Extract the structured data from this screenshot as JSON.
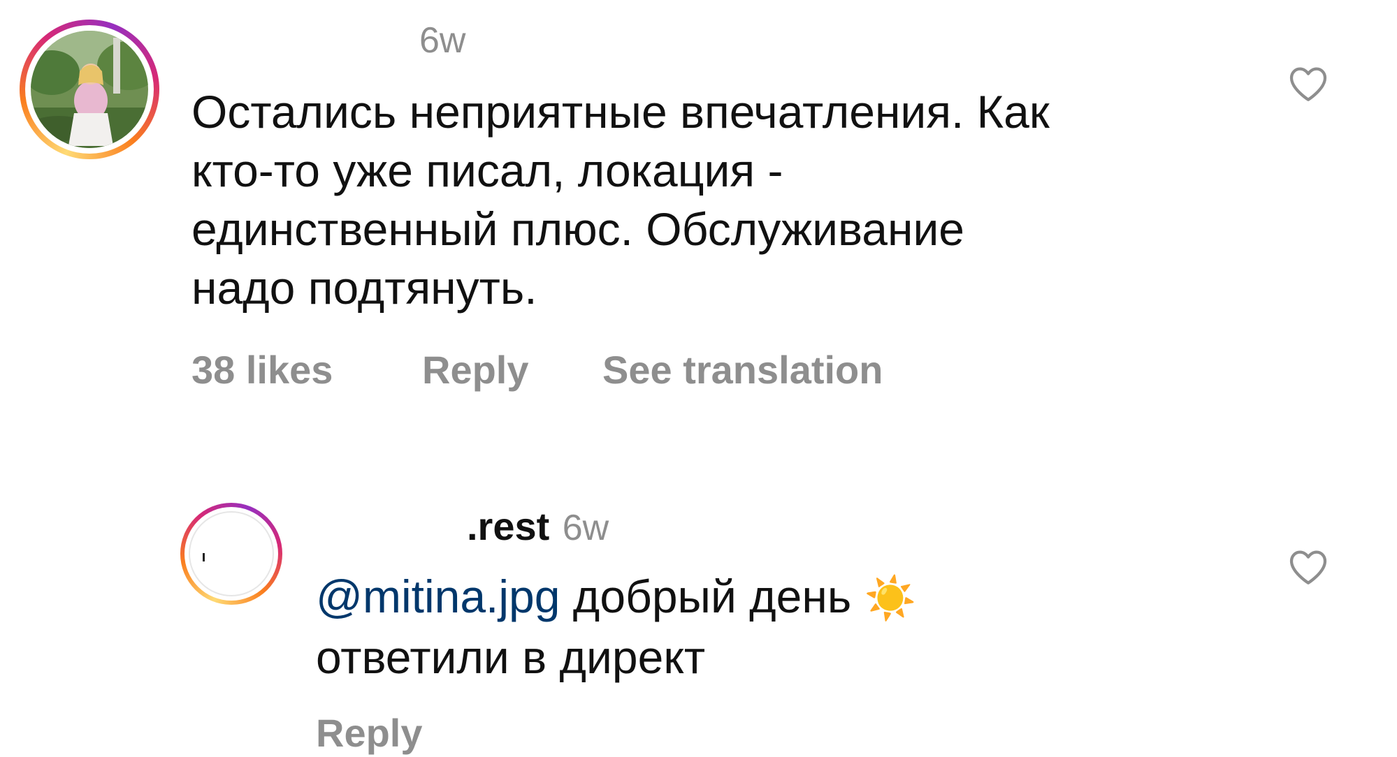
{
  "comment": {
    "time": "6w",
    "lines": [
      "Остались неприятные впечатления. Как",
      "кто-то уже писал, локация -",
      "единственный плюс. Обслуживание",
      "надо подтянуть."
    ],
    "likes": "38 likes",
    "reply_label": "Reply",
    "translate_label": "See translation",
    "like_icon": "heart-outline-icon"
  },
  "reply": {
    "username": ".rest",
    "time": "6w",
    "mention": "@mitina.jpg",
    "line1_text": " добрый день ",
    "emoji": "☀️",
    "line2": "ответили в директ",
    "reply_label": "Reply",
    "like_icon": "heart-outline-icon"
  },
  "colors": {
    "meta_gray": "#8e8e8e",
    "mention_blue": "#00376b",
    "story_ring": [
      "#feda75",
      "#fa7e1e",
      "#d62976",
      "#962fbf"
    ]
  }
}
